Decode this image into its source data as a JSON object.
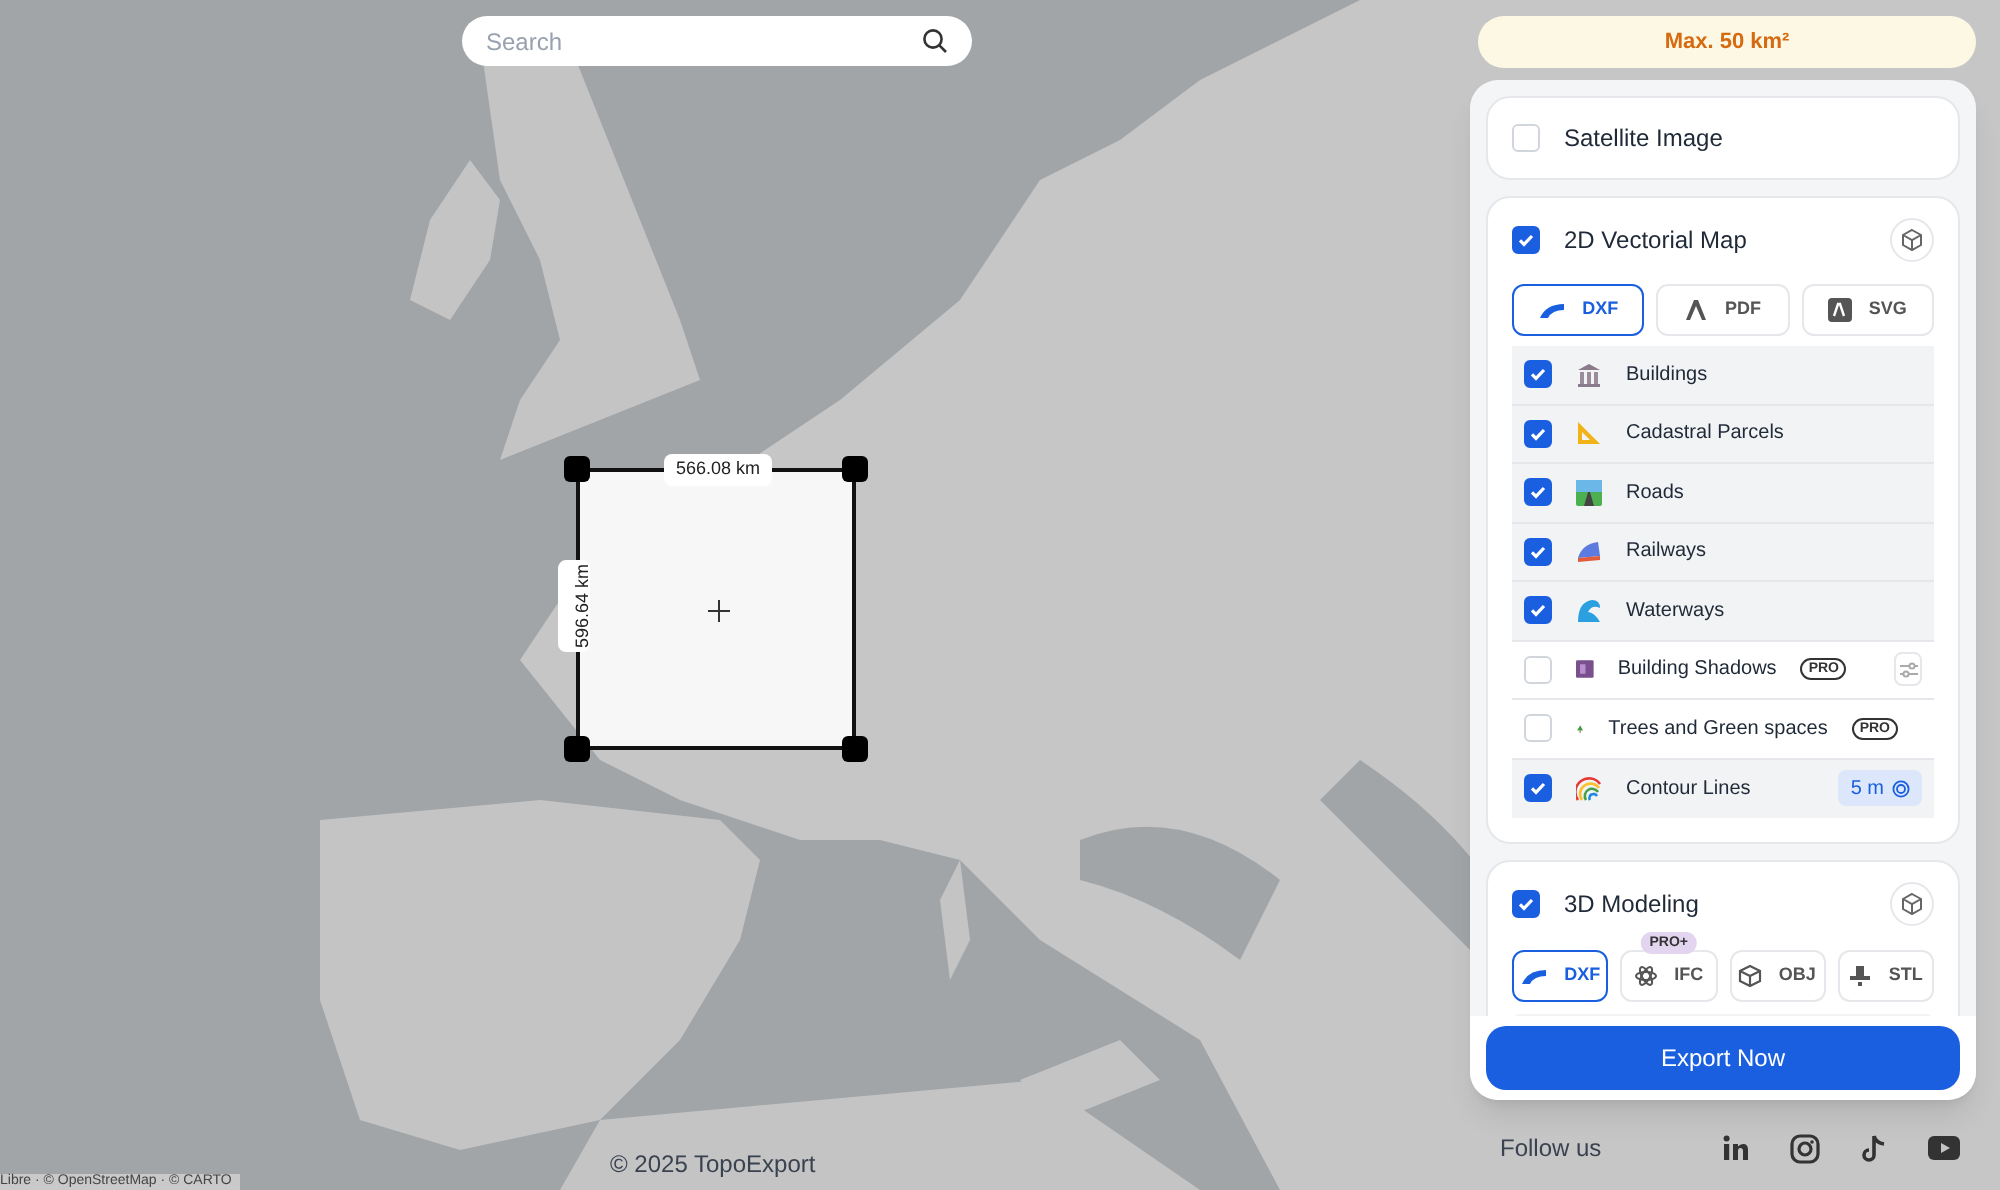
{
  "search": {
    "placeholder": "Search"
  },
  "selection": {
    "width_label": "566.08 km",
    "height_label": "596.64 km"
  },
  "area_limit": "Max. 50 km²",
  "satellite": {
    "label": "Satellite Image",
    "checked": false
  },
  "vector_map": {
    "label": "2D Vectorial Map",
    "checked": true,
    "formats": [
      {
        "label": "DXF",
        "selected": true
      },
      {
        "label": "PDF",
        "selected": false
      },
      {
        "label": "SVG",
        "selected": false
      }
    ],
    "layers": [
      {
        "label": "Buildings",
        "checked": true
      },
      {
        "label": "Cadastral Parcels",
        "checked": true
      },
      {
        "label": "Roads",
        "checked": true
      },
      {
        "label": "Railways",
        "checked": true
      },
      {
        "label": "Waterways",
        "checked": true
      },
      {
        "label": "Building Shadows",
        "checked": false,
        "badge": "PRO",
        "kind": "settings"
      },
      {
        "label": "Trees and Green spaces",
        "checked": false,
        "badge": "PRO",
        "kind": "plain"
      },
      {
        "label": "Contour Lines",
        "checked": true,
        "value": "5 m",
        "kind": "value"
      }
    ]
  },
  "modeling": {
    "label": "3D Modeling",
    "checked": true,
    "formats": [
      {
        "label": "DXF",
        "selected": true
      },
      {
        "label": "IFC",
        "selected": false,
        "badge": "PRO+"
      },
      {
        "label": "OBJ",
        "selected": false
      },
      {
        "label": "STL",
        "selected": false
      }
    ]
  },
  "export_button": "Export Now",
  "follow_label": "Follow us",
  "copyright": "© 2025 TopoExport",
  "attribution": "Libre · © OpenStreetMap · © CARTO"
}
